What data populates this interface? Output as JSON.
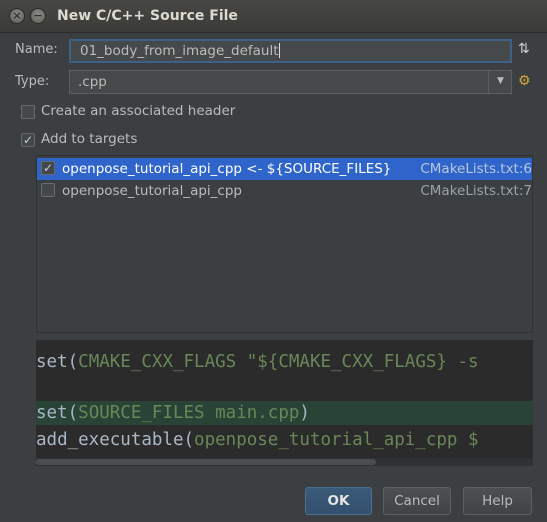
{
  "window": {
    "title": "New C/C++ Source File"
  },
  "form": {
    "name_label": "Name:",
    "name_value": "01_body_from_image_default",
    "sort_icon": "⇅",
    "type_label": "Type:",
    "type_value": ".cpp",
    "settings_icon": "⚙"
  },
  "options": {
    "create_header_label": "Create an associated header",
    "create_header_checked": false,
    "add_targets_label": "Add to targets",
    "add_targets_checked": true
  },
  "targets": [
    {
      "name": "openpose_tutorial_api_cpp <- ${SOURCE_FILES}",
      "source": "CMakeLists.txt:6",
      "checked": true,
      "selected": true
    },
    {
      "name": "openpose_tutorial_api_cpp",
      "source": "CMakeLists.txt:7",
      "checked": false,
      "selected": false
    }
  ],
  "code": {
    "line1_fn": "set(",
    "line1_var": "CMAKE_CXX_FLAGS",
    "line1_str": " \"${CMAKE_CXX_FLAGS} -s",
    "line2": "",
    "line3_fn": "set(",
    "line3_args": "SOURCE_FILES main.cpp",
    "line3_end": ")",
    "line4_fn": "add_executable(",
    "line4_args": "openpose_tutorial_api_cpp $"
  },
  "buttons": {
    "ok": "OK",
    "cancel": "Cancel",
    "help": "Help"
  },
  "colors": {
    "accent_selection": "#2f65ca",
    "focus_border": "#3d6185",
    "code_highlight": "#294436",
    "code_string": "#6a8759"
  }
}
